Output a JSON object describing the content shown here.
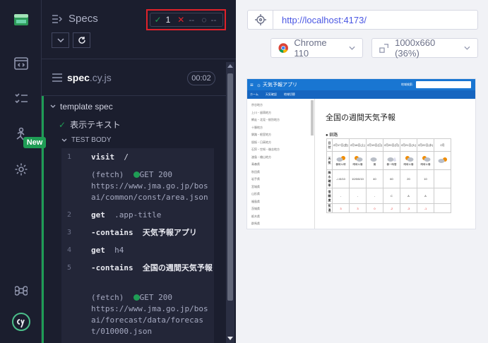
{
  "sidebar": {
    "new_badge": "New"
  },
  "header": {
    "title": "Specs",
    "passed": "1",
    "failed": "--",
    "pending": "--"
  },
  "spec": {
    "name": "spec",
    "ext": ".cy.js",
    "duration": "00:02"
  },
  "tree": {
    "suite": "template spec",
    "test": "表示テキスト",
    "body_label": "TEST BODY"
  },
  "commands": [
    {
      "num": "1",
      "name": "visit",
      "arg": "/"
    },
    {
      "fetch_label": "(fetch)",
      "method": "GET 200",
      "url": "https://www.jma.go.jp/bosai/common/const/area.json"
    },
    {
      "num": "2",
      "name": "get",
      "arg": ".app-title"
    },
    {
      "num": "3",
      "name": "-contains",
      "arg": "天気予報アプリ"
    },
    {
      "num": "4",
      "name": "get",
      "arg": "h4"
    },
    {
      "num": "5",
      "name": "-contains",
      "arg": "全国の週間天気予報"
    },
    {
      "fetch_label": "(fetch)",
      "method": "GET 200",
      "url": "https://www.jma.go.jp/bosai/forecast/data/forecast/010000.json"
    }
  ],
  "browser": {
    "url": "http://localhost:4173/",
    "name": "Chrome 110",
    "viewport": "1000x660 (36%)"
  },
  "aut": {
    "app_title": "天気予報アプリ",
    "region_label": "地域検索:",
    "nav": [
      "ホーム",
      "天気確認",
      "地域切替"
    ],
    "heading": "全国の週間天気予報",
    "region": "釧路",
    "sidebar_items": [
      "宗谷地方",
      "上川・留萌地方",
      "網走・北見・紋別地方",
      "十勝地方",
      "釧路・根室地方",
      "胆振・日高地方",
      "石狩・空知・後志地方",
      "渡島・檜山地方",
      "青森県",
      "秋田県",
      "岩手県",
      "宮城県",
      "山形県",
      "福島県",
      "茨城県",
      "栃木県",
      "群馬県"
    ],
    "row_labels": [
      "日付",
      "天気",
      "降水確率",
      "信頼度",
      "気温"
    ],
    "dates": [
      "2月17日(金)",
      "2月18日(土)",
      "2月19日(日)",
      "2月20日(月)",
      "2月21日(火)",
      "2月22日(水)",
      "2月"
    ],
    "weather": [
      "曇時々晴",
      "晴時々曇",
      "曇",
      "曇一時雪",
      "晴時々曇",
      "晴時々曇",
      ""
    ],
    "pop": [
      "-/-/0/10",
      "10/0/0/10",
      "40",
      "60",
      "20",
      "10",
      ""
    ],
    "reliability": [
      "-",
      "-",
      "-",
      "C",
      "A",
      "A",
      ""
    ],
    "temp": [
      "3",
      "3",
      "0",
      "-2",
      "-3",
      "-1",
      ""
    ]
  },
  "colors": {
    "accent_green": "#1f9d55",
    "fail_red": "#e0222a",
    "highlight_box": "#e0222a",
    "aut_blue": "#1976d2",
    "link": "#4956e3"
  }
}
